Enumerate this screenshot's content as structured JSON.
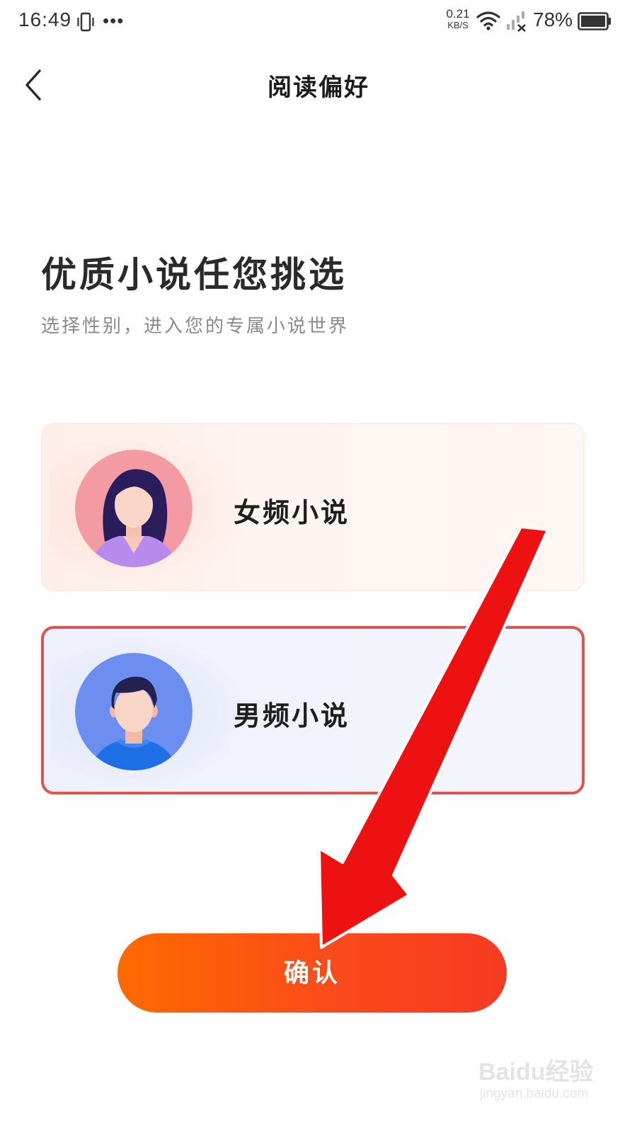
{
  "status_bar": {
    "time": "16:49",
    "more_dots": "•••",
    "net_speed_value": "0.21",
    "net_speed_unit": "KB/S",
    "battery_percent": "78%"
  },
  "nav": {
    "title": "阅读偏好"
  },
  "headline": "优质小说任您挑选",
  "subline": "选择性别，进入您的专属小说世界",
  "options": {
    "female": {
      "label": "女频小说",
      "selected": false
    },
    "male": {
      "label": "男频小说",
      "selected": true
    }
  },
  "confirm_label": "确认",
  "watermark": {
    "logo": "Baidu经验",
    "url": "jingyan.baidu.com"
  },
  "colors": {
    "accent": "#f5421f",
    "selected_border": "#d9574e",
    "annotation_arrow": "#ee1111"
  }
}
